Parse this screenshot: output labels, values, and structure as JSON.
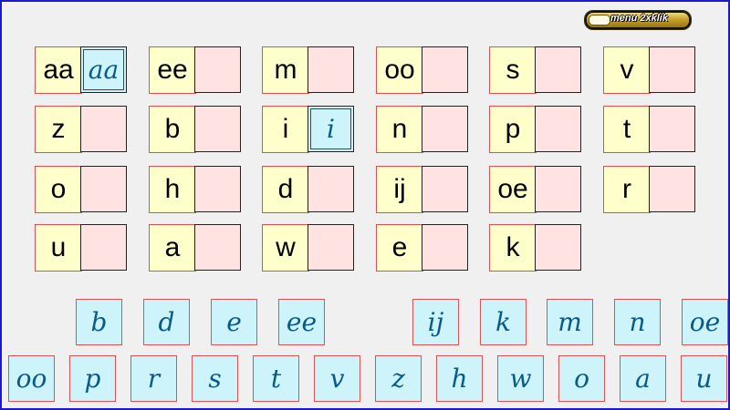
{
  "menu": {
    "label": "menu 2xklik"
  },
  "pairs": [
    {
      "letter": "aa",
      "filled": "aa"
    },
    {
      "letter": "ee",
      "filled": ""
    },
    {
      "letter": "m",
      "filled": ""
    },
    {
      "letter": "oo",
      "filled": ""
    },
    {
      "letter": "s",
      "filled": ""
    },
    {
      "letter": "v",
      "filled": ""
    },
    {
      "letter": "z",
      "filled": ""
    },
    {
      "letter": "b",
      "filled": ""
    },
    {
      "letter": "i",
      "filled": "i"
    },
    {
      "letter": "n",
      "filled": ""
    },
    {
      "letter": "p",
      "filled": ""
    },
    {
      "letter": "t",
      "filled": ""
    },
    {
      "letter": "o",
      "filled": ""
    },
    {
      "letter": "h",
      "filled": ""
    },
    {
      "letter": "d",
      "filled": ""
    },
    {
      "letter": "ij",
      "filled": ""
    },
    {
      "letter": "oe",
      "filled": ""
    },
    {
      "letter": "r",
      "filled": ""
    },
    {
      "letter": "u",
      "filled": ""
    },
    {
      "letter": "a",
      "filled": ""
    },
    {
      "letter": "w",
      "filled": ""
    },
    {
      "letter": "e",
      "filled": ""
    },
    {
      "letter": "k",
      "filled": ""
    }
  ],
  "tiles_row1": [
    "b",
    "d",
    "e",
    "ee",
    "ij",
    "k",
    "m",
    "n",
    "oe"
  ],
  "tiles_row2": [
    "oo",
    "p",
    "r",
    "s",
    "t",
    "v",
    "z",
    "h",
    "w",
    "o",
    "a",
    "u"
  ]
}
